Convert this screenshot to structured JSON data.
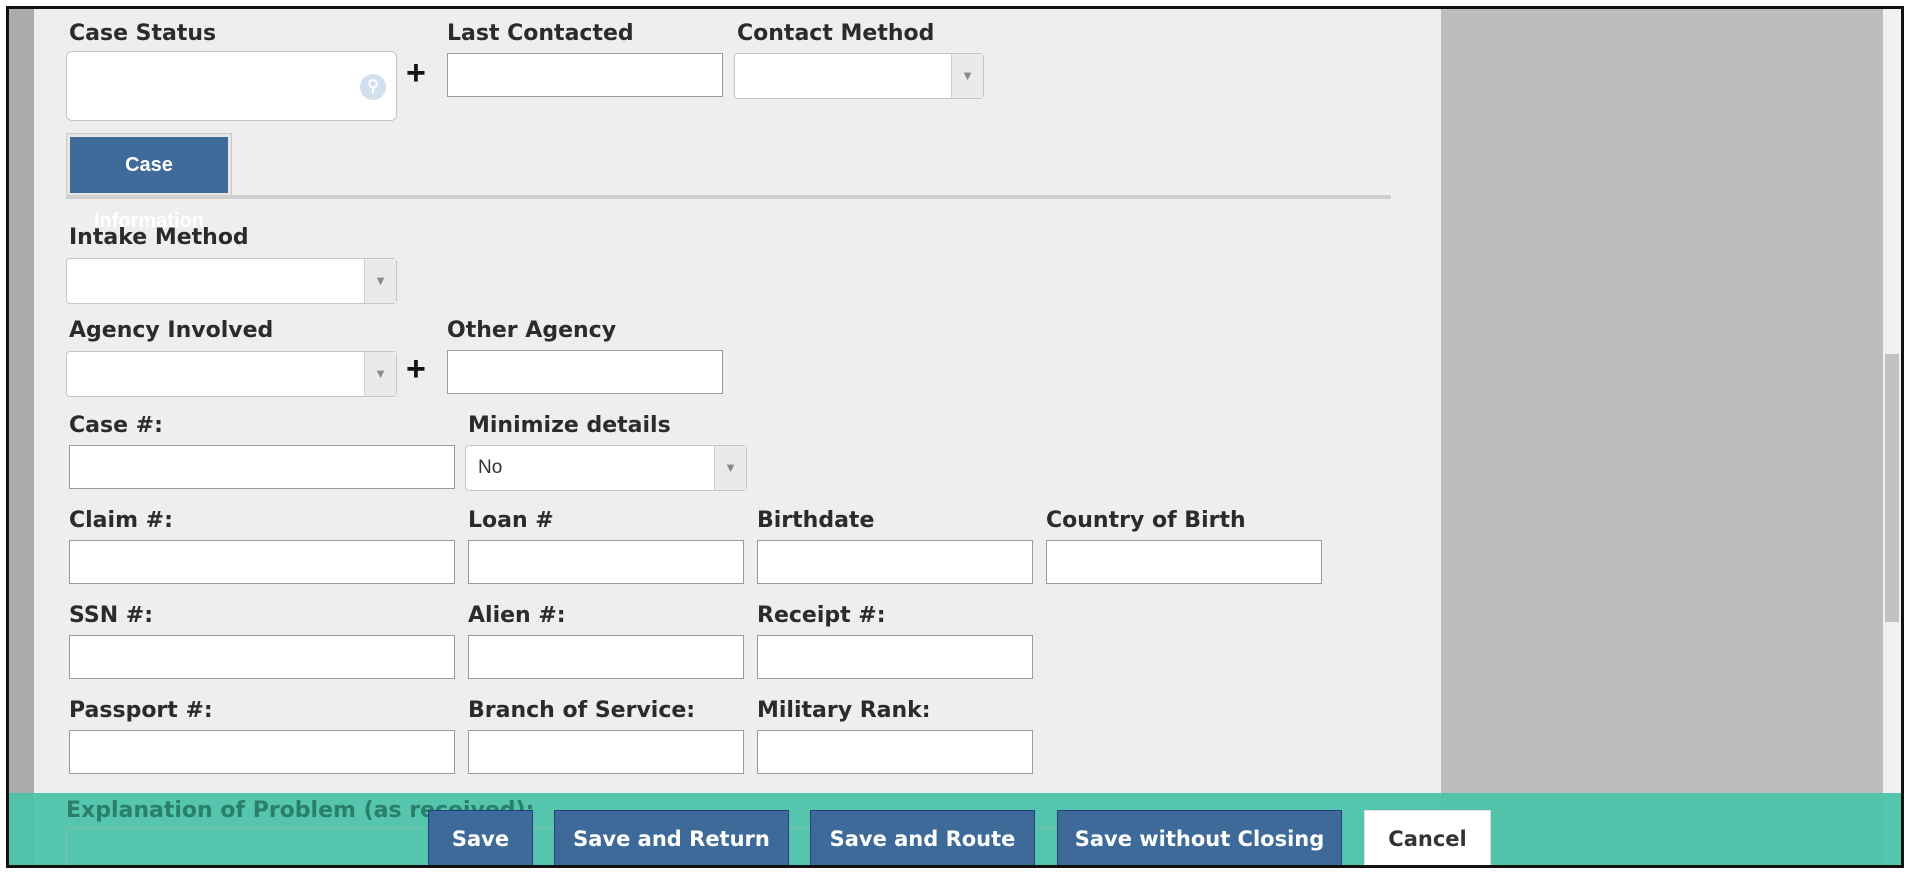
{
  "case_status": {
    "label": "Case Status",
    "value": ""
  },
  "last_contacted": {
    "label": "Last Contacted",
    "value": ""
  },
  "contact_method": {
    "label": "Contact Method",
    "value": ""
  },
  "section": {
    "case_information_label": "Case Information"
  },
  "intake_method": {
    "label": "Intake Method",
    "value": ""
  },
  "agency_involved": {
    "label": "Agency Involved",
    "value": ""
  },
  "other_agency": {
    "label": "Other Agency",
    "value": ""
  },
  "case_number": {
    "label": "Case #:",
    "value": ""
  },
  "minimize_details": {
    "label": "Minimize details",
    "value": "No"
  },
  "claim_number": {
    "label": "Claim #:",
    "value": ""
  },
  "loan_number": {
    "label": "Loan #",
    "value": ""
  },
  "birthdate": {
    "label": "Birthdate",
    "value": ""
  },
  "country_of_birth": {
    "label": "Country of Birth",
    "value": ""
  },
  "ssn_number": {
    "label": "SSN #:",
    "value": ""
  },
  "alien_number": {
    "label": "Alien #:",
    "value": ""
  },
  "receipt_number": {
    "label": "Receipt #:",
    "value": ""
  },
  "passport_number": {
    "label": "Passport #:",
    "value": ""
  },
  "branch_of_service": {
    "label": "Branch of Service:",
    "value": ""
  },
  "military_rank": {
    "label": "Military Rank:",
    "value": ""
  },
  "explanation": {
    "label": "Explanation of Problem (as received):"
  },
  "icons": {
    "add": "+",
    "search": "search-icon",
    "caret": "▼"
  },
  "colors": {
    "primary_button": "#3d6a99",
    "footer_bar": "#4cc3a9",
    "panel": "#eeeeee"
  },
  "footer": {
    "save": "Save",
    "save_and_return": "Save and Return",
    "save_and_route": "Save and Route",
    "save_without_closing": "Save without Closing",
    "cancel": "Cancel"
  }
}
